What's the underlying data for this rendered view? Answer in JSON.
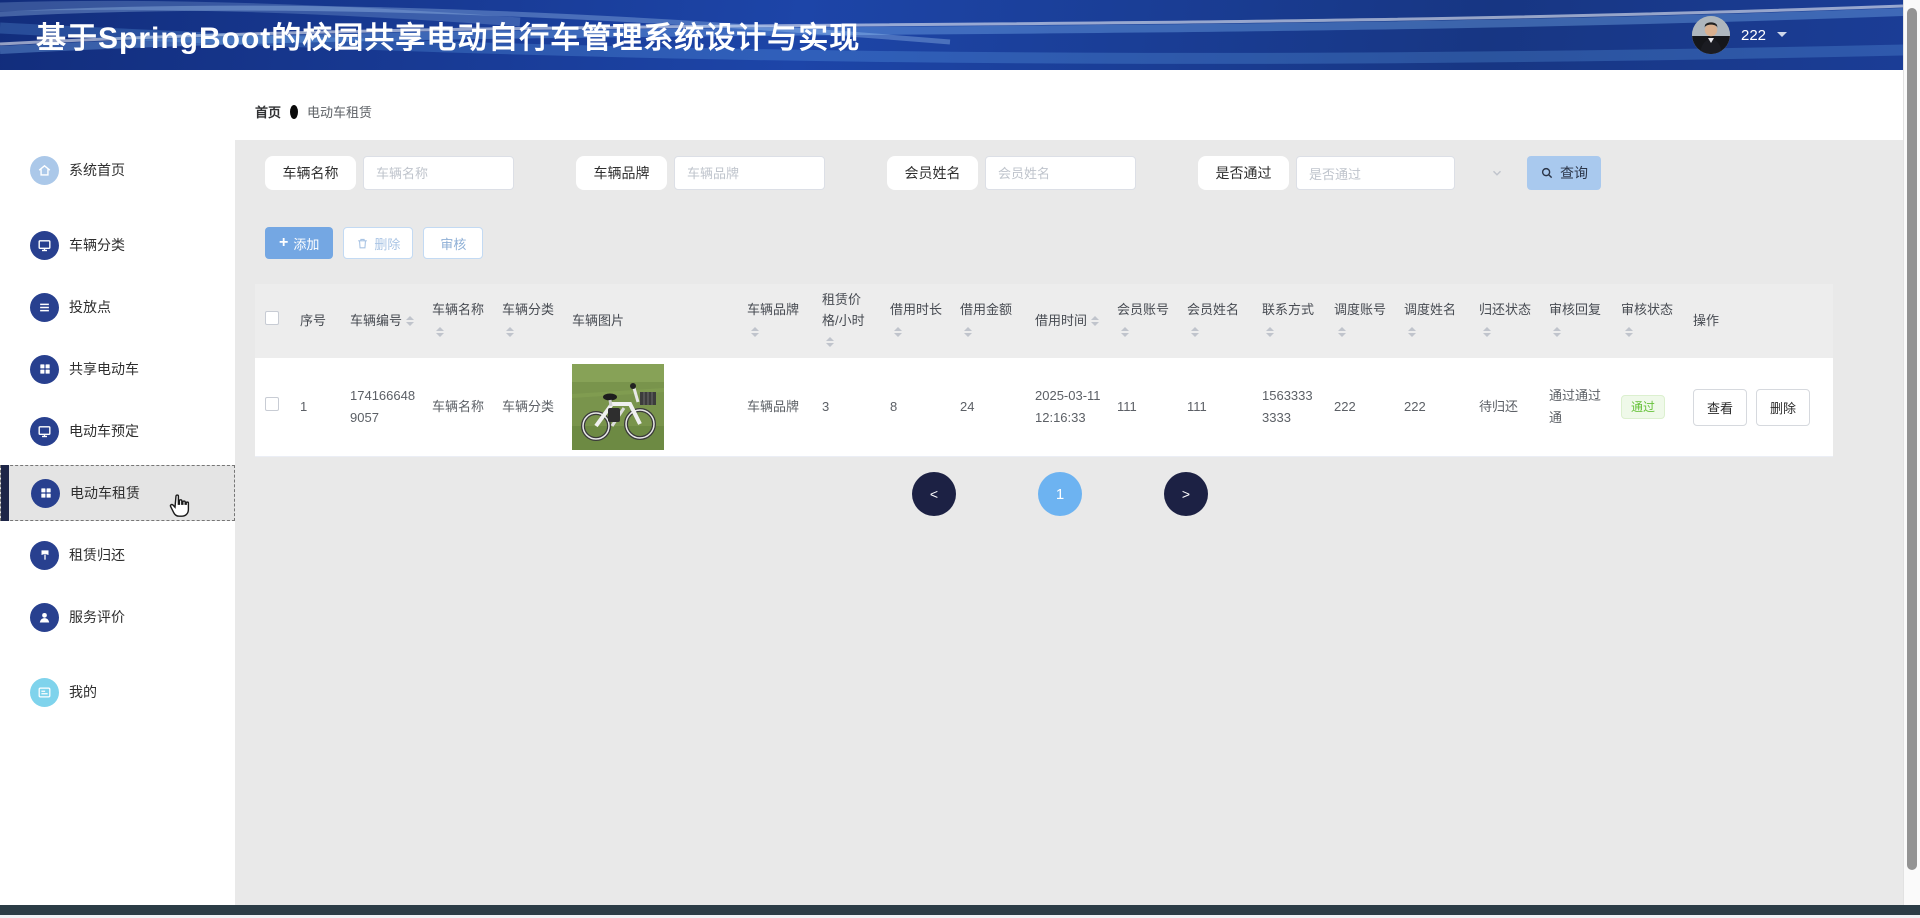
{
  "colors": {
    "header_blue": "#1d45a8",
    "accent_blue": "#74a7e3",
    "search_button_blue": "#a9c9ee",
    "pagination_active_blue": "#6db3f1",
    "pagination_dark_navy": "#1c2144",
    "success_green": "#67c23a",
    "sidebar_icon_navy": "#28408f"
  },
  "header": {
    "title": "基于SpringBoot的校园共享电动自行车管理系统设计与实现",
    "username": "222"
  },
  "sidebar": {
    "items": [
      {
        "label": "系统首页",
        "icon": "home-icon"
      },
      {
        "label": "车辆分类",
        "icon": "monitor-icon"
      },
      {
        "label": "投放点",
        "icon": "list-icon"
      },
      {
        "label": "共享电动车",
        "icon": "grid-icon"
      },
      {
        "label": "电动车预定",
        "icon": "monitor-icon"
      },
      {
        "label": "电动车租赁",
        "icon": "grid-icon",
        "active": true
      },
      {
        "label": "租赁归还",
        "icon": "flag-icon"
      },
      {
        "label": "服务评价",
        "icon": "user-icon"
      },
      {
        "label": "我的",
        "icon": "card-icon"
      }
    ]
  },
  "breadcrumb": {
    "home": "首页",
    "current": "电动车租赁"
  },
  "filters": {
    "vehicle_name": {
      "label": "车辆名称",
      "placeholder": "车辆名称"
    },
    "vehicle_brand": {
      "label": "车辆品牌",
      "placeholder": "车辆品牌"
    },
    "member_name": {
      "label": "会员姓名",
      "placeholder": "会员姓名"
    },
    "approved": {
      "label": "是否通过",
      "placeholder": "是否通过"
    },
    "search_label": "查询"
  },
  "toolbar": {
    "add_label": "添加",
    "delete_label": "删除",
    "audit_label": "审核"
  },
  "table": {
    "headers": [
      {
        "label": "序号",
        "sortable": false
      },
      {
        "label": "车辆编号",
        "sortable": true
      },
      {
        "label": "车辆名称",
        "sortable": true
      },
      {
        "label": "车辆分类",
        "sortable": true
      },
      {
        "label": "车辆图片",
        "sortable": false
      },
      {
        "label": "车辆品牌",
        "sortable": true
      },
      {
        "label": "租赁价格/小时",
        "sortable": true
      },
      {
        "label": "借用时长",
        "sortable": true
      },
      {
        "label": "借用金额",
        "sortable": true
      },
      {
        "label": "借用时间",
        "sortable": true
      },
      {
        "label": "会员账号",
        "sortable": true
      },
      {
        "label": "会员姓名",
        "sortable": true
      },
      {
        "label": "联系方式",
        "sortable": true
      },
      {
        "label": "调度账号",
        "sortable": true
      },
      {
        "label": "调度姓名",
        "sortable": true
      },
      {
        "label": "归还状态",
        "sortable": true
      },
      {
        "label": "审核回复",
        "sortable": true
      },
      {
        "label": "审核状态",
        "sortable": true
      },
      {
        "label": "操作",
        "sortable": false
      }
    ],
    "row": {
      "index": "1",
      "vehicle_no": "1741666489057",
      "vehicle_name": "车辆名称",
      "vehicle_category": "车辆分类",
      "vehicle_image_alt": "共享电动自行车图片",
      "vehicle_brand": "车辆品牌",
      "price_per_hour": "3",
      "duration": "8",
      "amount": "24",
      "borrow_time": "2025-03-11 12:16:33",
      "member_account": "111",
      "member_name": "111",
      "contact": "15633333333",
      "dispatch_account": "222",
      "dispatch_name": "222",
      "return_status": "待归还",
      "audit_reply": "通过通过通",
      "audit_status": "通过",
      "actions": {
        "view": "查看",
        "delete": "删除"
      }
    }
  },
  "pagination": {
    "prev": "<",
    "page": "1",
    "next": ">"
  }
}
